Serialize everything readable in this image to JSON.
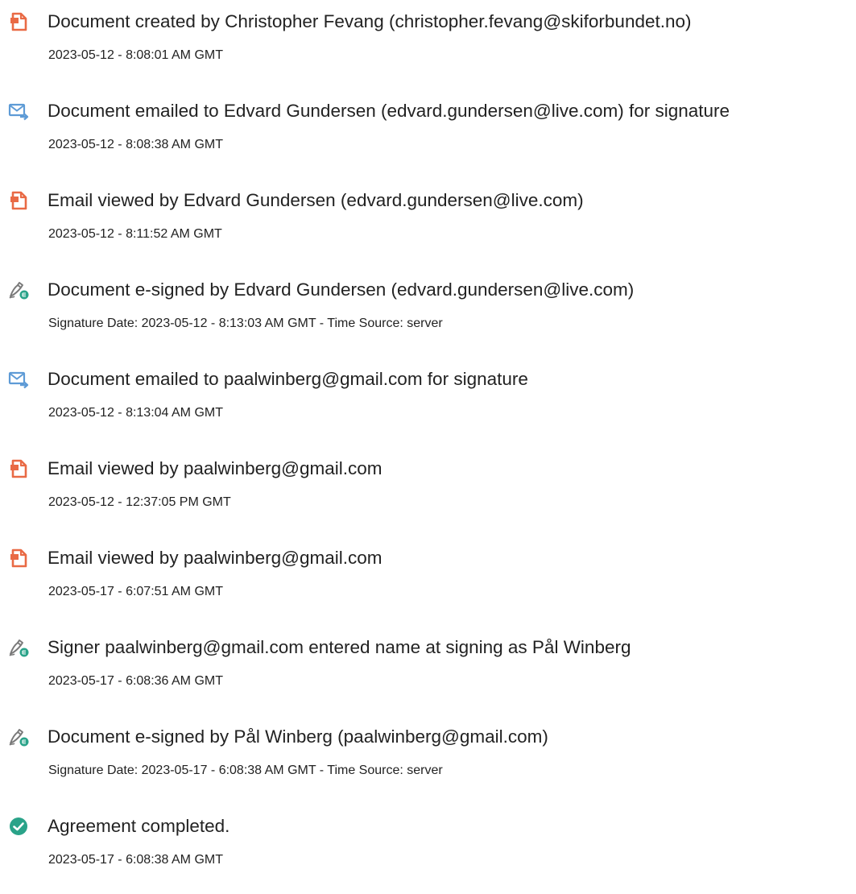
{
  "colors": {
    "document_icon": "#e96a45",
    "email_icon": "#5e9bd6",
    "signature_icon": "#7a7a7a",
    "signature_badge": "#2aa389",
    "completed_icon": "#2aa389"
  },
  "events": [
    {
      "icon": "document-icon",
      "title": "Document created by Christopher Fevang (christopher.fevang@skiforbundet.no)",
      "subtitle": "2023-05-12 - 8:08:01 AM GMT"
    },
    {
      "icon": "email-forward-icon",
      "title": "Document emailed to Edvard Gundersen (edvard.gundersen@live.com) for signature",
      "subtitle": "2023-05-12 - 8:08:38 AM GMT"
    },
    {
      "icon": "document-icon",
      "title": "Email viewed by Edvard Gundersen (edvard.gundersen@live.com)",
      "subtitle": "2023-05-12 - 8:11:52 AM GMT"
    },
    {
      "icon": "e-signature-icon",
      "title": "Document e-signed by Edvard Gundersen (edvard.gundersen@live.com)",
      "subtitle": "Signature Date: 2023-05-12 - 8:13:03 AM GMT - Time Source: server"
    },
    {
      "icon": "email-forward-icon",
      "title": "Document emailed to paalwinberg@gmail.com for signature",
      "subtitle": "2023-05-12 - 8:13:04 AM GMT"
    },
    {
      "icon": "document-icon",
      "title": "Email viewed by paalwinberg@gmail.com",
      "subtitle": "2023-05-12 - 12:37:05 PM GMT"
    },
    {
      "icon": "document-icon",
      "title": "Email viewed by paalwinberg@gmail.com",
      "subtitle": "2023-05-17 - 6:07:51 AM GMT"
    },
    {
      "icon": "e-signature-icon",
      "title": "Signer paalwinberg@gmail.com entered name at signing as Pål Winberg",
      "subtitle": "2023-05-17 - 6:08:36 AM GMT"
    },
    {
      "icon": "e-signature-icon",
      "title": "Document e-signed by Pål Winberg (paalwinberg@gmail.com)",
      "subtitle": "Signature Date: 2023-05-17 - 6:08:38 AM GMT - Time Source: server"
    },
    {
      "icon": "checkmark-circle-icon",
      "title": "Agreement completed.",
      "subtitle": "2023-05-17 - 6:08:38 AM GMT"
    }
  ]
}
